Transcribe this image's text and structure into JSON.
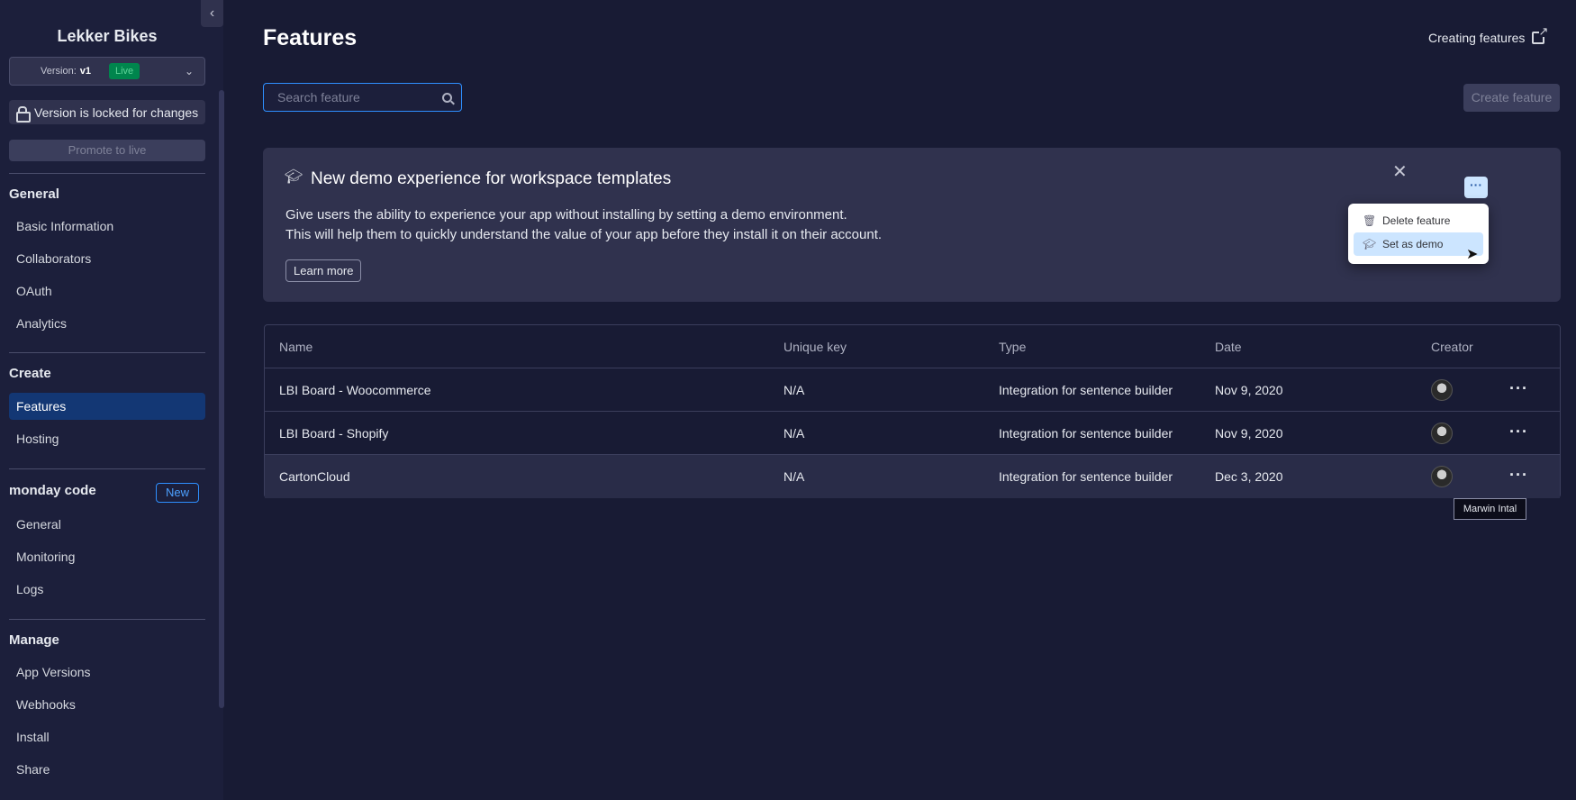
{
  "sidebar": {
    "app_name": "Lekker Bikes",
    "version_label": "Version:",
    "version_value": "v1",
    "version_status": "Live",
    "locked_text": "Version is locked for changes",
    "promote_label": "Promote to live",
    "sections": {
      "general": {
        "title": "General",
        "items": [
          "Basic Information",
          "Collaborators",
          "OAuth",
          "Analytics"
        ]
      },
      "create": {
        "title": "Create",
        "items": [
          "Features",
          "Hosting"
        ]
      },
      "monday_code": {
        "title": "monday code",
        "badge": "New",
        "items": [
          "General",
          "Monitoring",
          "Logs"
        ]
      },
      "manage": {
        "title": "Manage",
        "items": [
          "App Versions",
          "Webhooks",
          "Install",
          "Share"
        ]
      }
    }
  },
  "header": {
    "title": "Features",
    "help_link": "Creating features"
  },
  "search": {
    "placeholder": "Search feature",
    "value": ""
  },
  "toolbar": {
    "create_label": "Create feature"
  },
  "banner": {
    "title": "New demo experience for workspace templates",
    "line1": "Give users the ability to experience your app without installing by setting a demo environment.",
    "line2": "This will help them to quickly understand the value of your app before they install it on their account.",
    "learn_more": "Learn more",
    "more_label": "···"
  },
  "menu": {
    "items": [
      "Delete feature",
      "Set as demo"
    ],
    "hovered": "Set as demo"
  },
  "table": {
    "columns": [
      "Name",
      "Unique key",
      "Type",
      "Date",
      "Creator"
    ],
    "rows": [
      {
        "name": "LBI Board - Woocommerce",
        "key": "N/A",
        "type": "Integration for sentence builder",
        "date": "Nov 9, 2020",
        "more": "···"
      },
      {
        "name": "LBI Board - Shopify",
        "key": "N/A",
        "type": "Integration for sentence builder",
        "date": "Nov 9, 2020",
        "more": "···"
      },
      {
        "name": "CartonCloud",
        "key": "N/A",
        "type": "Integration for sentence builder",
        "date": "Dec 3, 2020",
        "more": "···"
      }
    ]
  },
  "tooltip": {
    "text": "Marwin Intal"
  },
  "colors": {
    "background": "#181b34",
    "sidebar": "#1c1f3b",
    "accent": "#2e8fff",
    "active_nav": "#133774",
    "live": "#00854d"
  }
}
